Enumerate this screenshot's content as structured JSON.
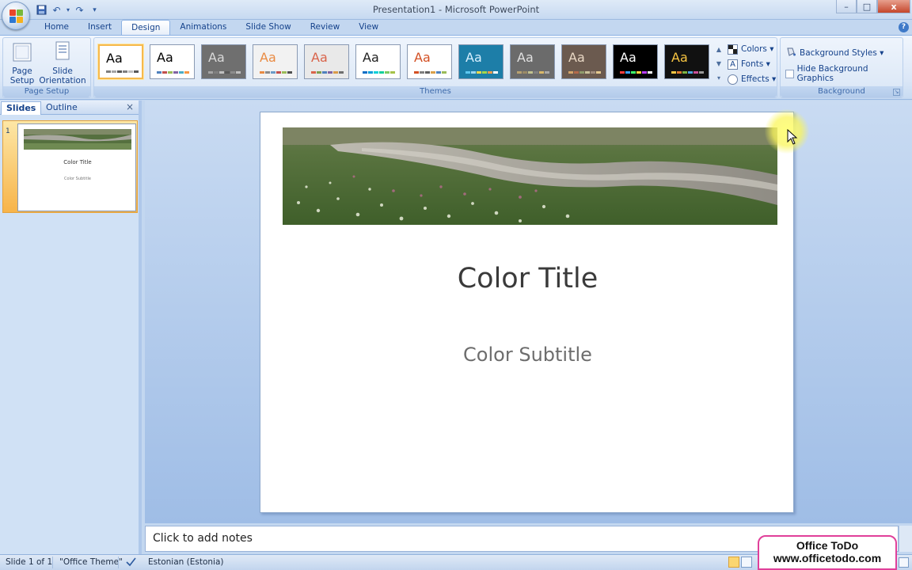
{
  "window": {
    "title": "Presentation1 - Microsoft PowerPoint",
    "controls": {
      "minimize": "–",
      "maximize": "□",
      "close": "x"
    }
  },
  "qat": {
    "save": "💾",
    "undo": "↶",
    "redo": "↷",
    "customize": "▾"
  },
  "tabs": [
    "Home",
    "Insert",
    "Design",
    "Animations",
    "Slide Show",
    "Review",
    "View"
  ],
  "active_tab": "Design",
  "help": "?",
  "ribbon": {
    "page_setup": {
      "label": "Page Setup",
      "page_setup_line1": "Page",
      "page_setup_line2": "Setup",
      "slide_orientation_line1": "Slide",
      "slide_orientation_line2": "Orientation ▾"
    },
    "themes": {
      "label": "Themes",
      "items": [
        {
          "aa": "Aa",
          "bg": "#ffffff",
          "fg": "#000000",
          "bars": [
            "#7f7f7f",
            "#a5a5a5",
            "#595959",
            "#7f7f7f",
            "#bfbfbf",
            "#595959"
          ]
        },
        {
          "aa": "Aa",
          "bg": "#ffffff",
          "fg": "#000000",
          "bars": [
            "#4f81bd",
            "#c0504d",
            "#9bbb59",
            "#8064a2",
            "#4bacc6",
            "#f79646"
          ]
        },
        {
          "aa": "Aa",
          "bg": "#6f6f6f",
          "fg": "#d9d9d9",
          "bars": [
            "#a5a5a5",
            "#7f7f7f",
            "#c0c0c0",
            "#595959",
            "#8c8c8c",
            "#bfbfbf"
          ]
        },
        {
          "aa": "Aa",
          "bg": "#f2f2f2",
          "fg": "#e98b43",
          "bars": [
            "#e98b43",
            "#8a8a8a",
            "#6b9bc7",
            "#c0504d",
            "#9bbb59",
            "#4f4f4f"
          ]
        },
        {
          "aa": "Aa",
          "bg": "#e9e9e9",
          "fg": "#d9644a",
          "bars": [
            "#d9644a",
            "#7e9e4f",
            "#4f81bd",
            "#8064a2",
            "#d99b4a",
            "#6f6f6f"
          ]
        },
        {
          "aa": "Aa",
          "bg": "#ffffff",
          "fg": "#1f1f1f",
          "bars": [
            "#0f6fc6",
            "#009dd9",
            "#0bd0d9",
            "#10cf9b",
            "#7cca62",
            "#a5c249"
          ]
        },
        {
          "aa": "Aa",
          "bg": "#ffffff",
          "fg": "#d35024",
          "bars": [
            "#d35024",
            "#7f7f7f",
            "#5f5f5f",
            "#d9a04a",
            "#4f81bd",
            "#9bbb59"
          ]
        },
        {
          "aa": "Aa",
          "bg": "#1d7ea8",
          "fg": "#d8f0ff",
          "bars": [
            "#5ec7f0",
            "#9bd6f0",
            "#f0d94a",
            "#a5d64a",
            "#f09a4a",
            "#ffffff"
          ]
        },
        {
          "aa": "Aa",
          "bg": "#6b6b6b",
          "fg": "#e0e0e0",
          "bars": [
            "#b8a270",
            "#9a8a66",
            "#c2c28f",
            "#7f7f7f",
            "#d9b86a",
            "#a8a8a8"
          ]
        },
        {
          "aa": "Aa",
          "bg": "#6b5a4f",
          "fg": "#e9d8c5",
          "bars": [
            "#d4a56a",
            "#b36a4a",
            "#8e9a6b",
            "#c9c19a",
            "#a08c7d",
            "#e4c98f"
          ]
        },
        {
          "aa": "Aa",
          "bg": "#000000",
          "fg": "#ffffff",
          "bars": [
            "#ff3d3d",
            "#3da1ff",
            "#3dff6b",
            "#ffd83d",
            "#b83dff",
            "#ffffff"
          ]
        },
        {
          "aa": "Aa",
          "bg": "#111111",
          "fg": "#f7c542",
          "bars": [
            "#f7c542",
            "#e07a2f",
            "#7cb342",
            "#4aa3df",
            "#c94f9a",
            "#9a9a9a"
          ]
        }
      ]
    },
    "theme_options": {
      "colors": "Colors ▾",
      "fonts": "Fonts ▾",
      "effects": "Effects ▾",
      "fonts_icon": "A"
    },
    "background": {
      "label": "Background",
      "styles": "Background Styles ▾",
      "hide": "Hide Background Graphics"
    }
  },
  "left_pane": {
    "tabs": [
      "Slides",
      "Outline"
    ],
    "close": "×",
    "slide_number": "1",
    "thumb_title": "Color Title",
    "thumb_subtitle": "Color Subtitle"
  },
  "slide": {
    "title": "Color Title",
    "subtitle": "Color Subtitle"
  },
  "notes": {
    "placeholder": "Click to add notes"
  },
  "status": {
    "slide": "Slide 1 of 1",
    "theme": "\"Office Theme\"",
    "language": "Estonian (Estonia)"
  },
  "watermark": {
    "line1": "Office ToDo",
    "line2": "www.officetodo.com"
  }
}
